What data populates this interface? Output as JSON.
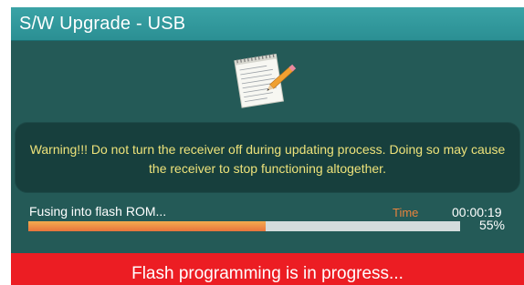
{
  "window": {
    "title": "S/W Upgrade - USB"
  },
  "icon": {
    "name": "notepad-pencil-icon"
  },
  "warning": {
    "text": "Warning!!! Do not turn the receiver off during updating process. Doing so may cause the receiver to stop functioning altogether."
  },
  "progress": {
    "status": "Fusing into flash ROM...",
    "time_label": "Time",
    "time_value": "00:00:19",
    "percent_text": "55%",
    "fraction": 0.55
  },
  "banner": {
    "text": "Flash programming is in progress..."
  },
  "colors": {
    "background": "#245a57",
    "titlebar": "#2b8f93",
    "warning_text": "#ede27a",
    "time_label": "#e9843e",
    "progress_fill": "#e8743c",
    "progress_track": "#d3dcdc",
    "banner": "#ec1d23"
  }
}
